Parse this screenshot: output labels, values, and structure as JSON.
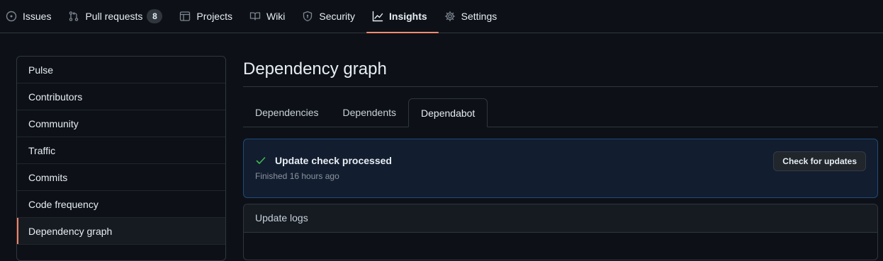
{
  "nav": {
    "items": [
      {
        "label": "Issues",
        "icon": "issue-opened-icon",
        "selected": false
      },
      {
        "label": "Pull requests",
        "icon": "git-pull-request-icon",
        "counter": "8",
        "selected": false
      },
      {
        "label": "Projects",
        "icon": "table-icon",
        "selected": false
      },
      {
        "label": "Wiki",
        "icon": "book-icon",
        "selected": false
      },
      {
        "label": "Security",
        "icon": "shield-icon",
        "selected": false
      },
      {
        "label": "Insights",
        "icon": "graph-icon",
        "selected": true
      },
      {
        "label": "Settings",
        "icon": "gear-icon",
        "selected": false
      }
    ]
  },
  "sidebar": {
    "items": [
      {
        "label": "Pulse"
      },
      {
        "label": "Contributors"
      },
      {
        "label": "Community"
      },
      {
        "label": "Traffic"
      },
      {
        "label": "Commits"
      },
      {
        "label": "Code frequency"
      },
      {
        "label": "Dependency graph",
        "selected": true
      }
    ]
  },
  "main": {
    "title": "Dependency graph",
    "tabs": [
      {
        "label": "Dependencies"
      },
      {
        "label": "Dependents"
      },
      {
        "label": "Dependabot",
        "selected": true
      }
    ],
    "flash": {
      "title": "Update check processed",
      "subtitle": "Finished 16 hours ago",
      "button": "Check for updates",
      "icon": "check-icon"
    },
    "logs": {
      "header": "Update logs"
    }
  },
  "colors": {
    "background": "#0d1117",
    "accent_underline": "#fd8c73",
    "success": "#3fb950",
    "flash_bg": "#121d2f",
    "flash_border": "#1f4a7a"
  }
}
